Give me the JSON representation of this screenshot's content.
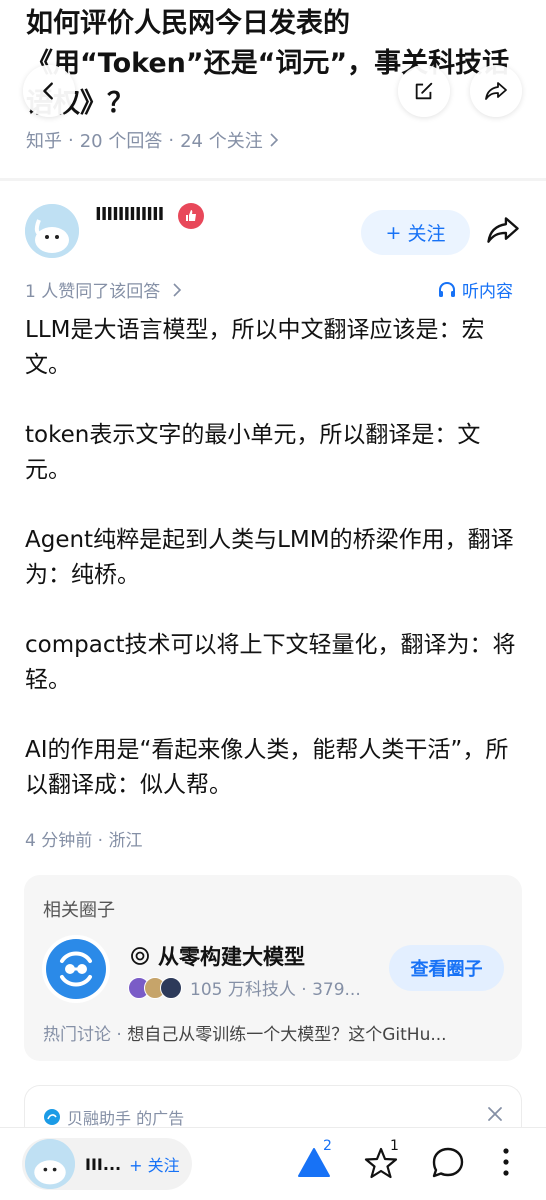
{
  "question": {
    "title": "如何评价人民网今日发表的《用“Token”还是“词元”，事关科技话语权》？",
    "source": "知乎",
    "answers_count": "20 个回答",
    "followers_count": "24 个关注",
    "separator": "·"
  },
  "author": {
    "name": "IIIIIIIIIIII",
    "follow_label": "关注",
    "follow_plus": "+"
  },
  "answer_info": {
    "vote_text": "1 人赞同了该回答",
    "listen_label": "听内容",
    "paragraphs": [
      "LLM是大语言模型，所以中文翻译应该是：宏文。",
      "token表示文字的最小单元，所以翻译是：文元。",
      "Agent纯粹是起到人类与LMM的桥梁作用，翻译为：纯桥。",
      "compact技术可以将上下文轻量化，翻译为：将轻。",
      "AI的作用是“看起来像人类，能帮人类干活”，所以翻译成：似人帮。"
    ],
    "time": "4 分钟前",
    "location": "浙江"
  },
  "circle": {
    "heading": "相关圈子",
    "name": "从零构建大模型",
    "members": "105 万科技人 · 379...",
    "view_label": "查看圈子",
    "hot_label": "热门讨论 ·",
    "hot_text": "想自己从零训练一个大模型？这个GitHu..."
  },
  "ad": {
    "label": "贝融助手 的广告"
  },
  "bottom_bar": {
    "name": "III...",
    "follow_label": "+ 关注",
    "upvote_count": "2",
    "favorite_count": "1"
  },
  "colors": {
    "accent": "#1772f6",
    "muted": "#8590a6",
    "badge": "#e8485a"
  }
}
